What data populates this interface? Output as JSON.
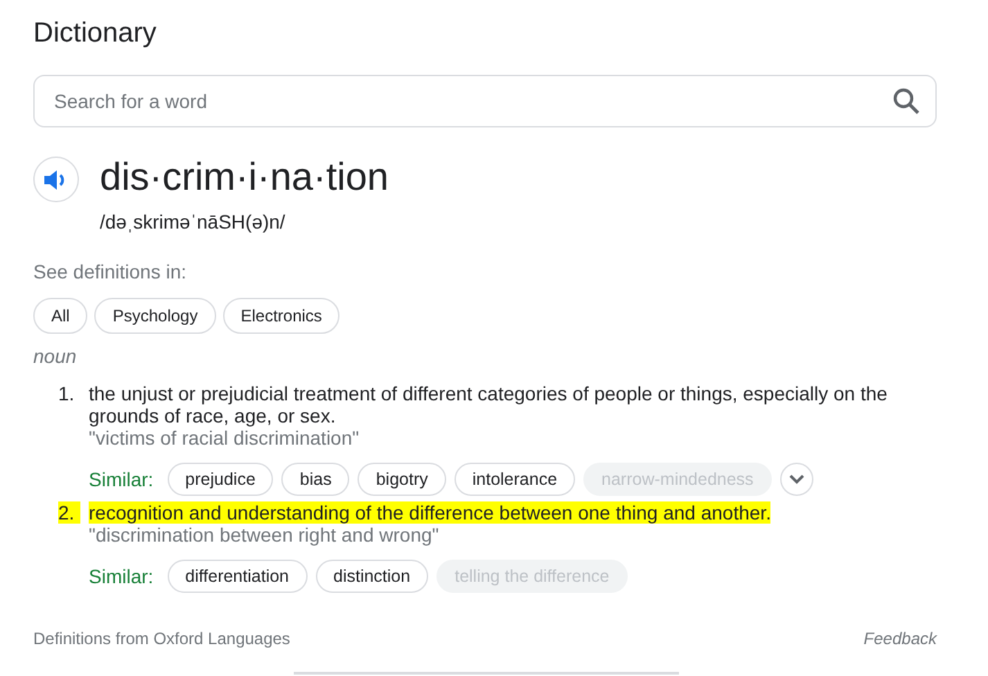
{
  "title": "Dictionary",
  "search": {
    "placeholder": "Search for a word"
  },
  "entry": {
    "word": "dis·crim·i·na·tion",
    "phonetic": "/dəˌskriməˈnāSH(ə)n/"
  },
  "see_definitions_label": "See definitions in:",
  "domains": [
    {
      "label": "All"
    },
    {
      "label": "Psychology"
    },
    {
      "label": "Electronics"
    }
  ],
  "part_of_speech": "noun",
  "definitions": [
    {
      "number": "1.",
      "text": "the unjust or prejudicial treatment of different categories of people or things, especially on the grounds of race, age, or sex.",
      "example": "\"victims of racial discrimination\"",
      "highlighted": false,
      "similar_label": "Similar:",
      "similar": [
        {
          "label": "prejudice",
          "disabled": false
        },
        {
          "label": "bias",
          "disabled": false
        },
        {
          "label": "bigotry",
          "disabled": false
        },
        {
          "label": "intolerance",
          "disabled": false
        },
        {
          "label": "narrow-mindedness",
          "disabled": true
        }
      ],
      "expandable": true
    },
    {
      "number": "2.",
      "text": "recognition and understanding of the difference between one thing and another.",
      "example": "\"discrimination between right and wrong\"",
      "highlighted": true,
      "similar_label": "Similar:",
      "similar": [
        {
          "label": "differentiation",
          "disabled": false
        },
        {
          "label": "distinction",
          "disabled": false
        },
        {
          "label": "telling the difference",
          "disabled": true
        }
      ],
      "expandable": false
    }
  ],
  "footer": {
    "source": "Definitions from Oxford Languages",
    "feedback": "Feedback"
  }
}
